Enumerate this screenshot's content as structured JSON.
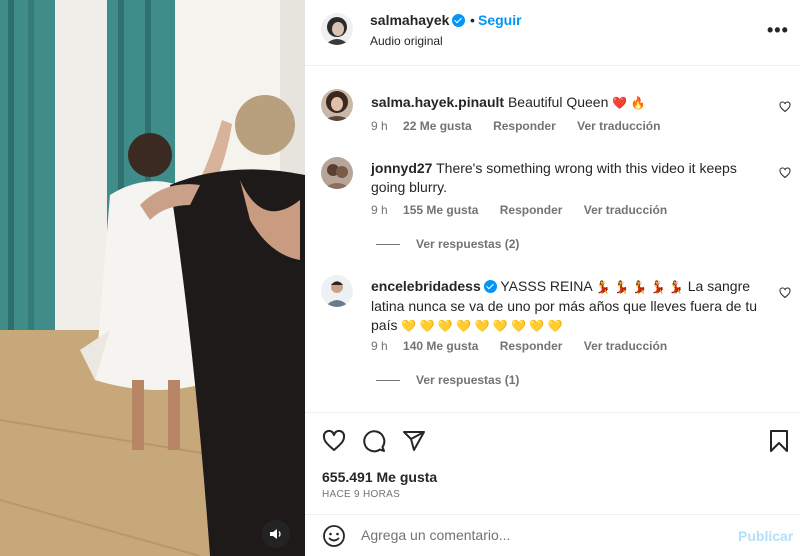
{
  "post": {
    "username": "salmahayek",
    "separator": "•",
    "follow_label": "Seguir",
    "audio": "Audio original",
    "more_label": "•••"
  },
  "comments": [
    {
      "username": "salma.hayek.pinault",
      "text": "Beautiful Queen",
      "emojis": "❤️ 🔥",
      "time": "9 h",
      "likes": "22 Me gusta",
      "reply_label": "Responder",
      "translate_label": "Ver traducción"
    },
    {
      "username": "jonnyd27",
      "text": "There's something wrong with this video it keeps going blurry.",
      "time": "9 h",
      "likes": "155 Me gusta",
      "reply_label": "Responder",
      "translate_label": "Ver traducción",
      "view_replies": "Ver respuestas (2)"
    },
    {
      "username": "encelebridadess",
      "text_part1": "YASSS REINA",
      "emojis1": "💃 💃 💃 💃 💃",
      "text_part2": "La sangre latina nunca se va de uno por más años que lleves fuera de tu país",
      "emojis2": "💛 💛 💛 💛 💛 💛 💛 💛 💛",
      "time": "9 h",
      "likes": "140 Me gusta",
      "reply_label": "Responder",
      "translate_label": "Ver traducción",
      "view_replies": "Ver respuestas (1)"
    }
  ],
  "stats": {
    "likes": "655.491 Me gusta",
    "time_ago": "HACE 9 HORAS"
  },
  "composer": {
    "placeholder": "Agrega un comentario...",
    "publish_label": "Publicar"
  },
  "icons": {
    "heart": "heart-icon",
    "comment": "comment-icon",
    "share": "paper-plane-icon",
    "save": "bookmark-icon",
    "emoji": "smiley-icon",
    "audio": "speaker-icon"
  },
  "colors": {
    "accent": "#0095f6",
    "publish_disabled": "#b2dffc",
    "secondary_text": "#737373"
  }
}
